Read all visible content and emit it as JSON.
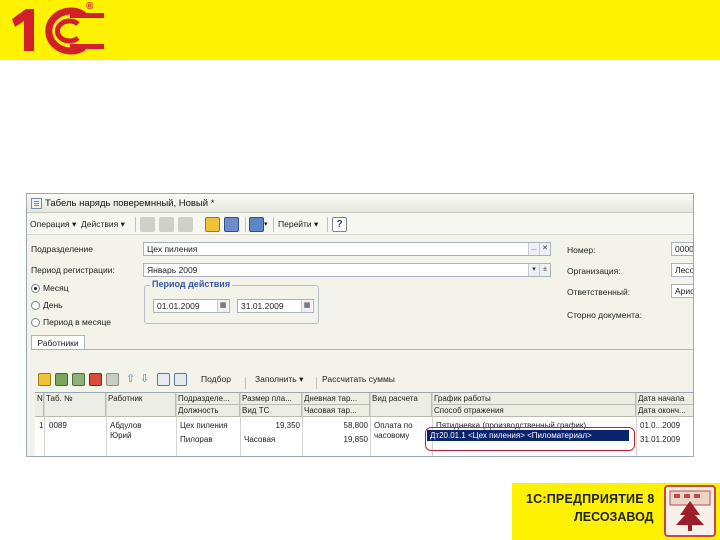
{
  "brand": {
    "logo_text": "1С",
    "registered_mark": "®"
  },
  "window": {
    "title": "Табель нарядь поверемнный, Новый *",
    "toolbar": {
      "operation": "Операция ▾",
      "actions": "Действия ▾",
      "goto": "Перейти ▾"
    },
    "fields": {
      "subdivision_label": "Подразделение",
      "subdivision_value": "Цех пиления",
      "period_label": "Период регистрации:",
      "period_value": "Январь 2009",
      "number_label": "Номер:",
      "number_value": "0000",
      "org_label": "Организация:",
      "org_value": "Лесоз",
      "responsible_label": "Ответственный:",
      "responsible_value": "Арис",
      "storno_label": "Сторно документа:"
    },
    "radios": [
      {
        "label": "Месяц",
        "selected": true
      },
      {
        "label": "День",
        "selected": false
      },
      {
        "label": "Период в месяце",
        "selected": false
      }
    ],
    "period_group": {
      "title": "Период действия",
      "from": "01.01.2009",
      "to": "31.01.2009"
    },
    "tab": "Работники",
    "table_toolbar": {
      "select": "Подбор",
      "fill": "Заполнить ▾",
      "calc": "Рассчитать суммы"
    },
    "columns": {
      "n": "N",
      "tab_no": "Таб. №",
      "worker": "Работник",
      "subdiv": "Подразделе...",
      "position": "Должность",
      "pay_size": "Размер пла...",
      "rate_type": "Вид ТС",
      "day_rate": "Дневная тар...",
      "hour_rate": "Часовая тар...",
      "calc_type": "Вид расчета",
      "schedule": "График работы",
      "reflection": "Способ отражения",
      "start_date": "Дата начала",
      "end_date": "Дата оконч..."
    },
    "row": {
      "n": "1",
      "tab_no": "0089",
      "worker_1": "Абдулов",
      "worker_2": "Юрий",
      "subdiv": "Цех пиления",
      "position": "Пилорав",
      "pay_size": "19,350",
      "rate_type": "Часовая",
      "day_rate": "58,800",
      "hour_rate": "19,850",
      "calc_type_1": "Оплата по",
      "calc_type_2": "часовому",
      "schedule": "Пятидневка (производственный график)",
      "reflection": "Дт20.01.1 <Цех пиления> <Пиломатериал>",
      "start_date": "01.0...2009",
      "end_date": "31.01.2009"
    }
  },
  "product": {
    "line1": "1С:ПРЕДПРИЯТИЕ 8",
    "line2": "ЛЕСОЗАВОД"
  },
  "colors": {
    "brand_yellow": "#fff200",
    "brand_red": "#d2202a",
    "selection": "#0a246a",
    "highlight": "#c0243c"
  }
}
